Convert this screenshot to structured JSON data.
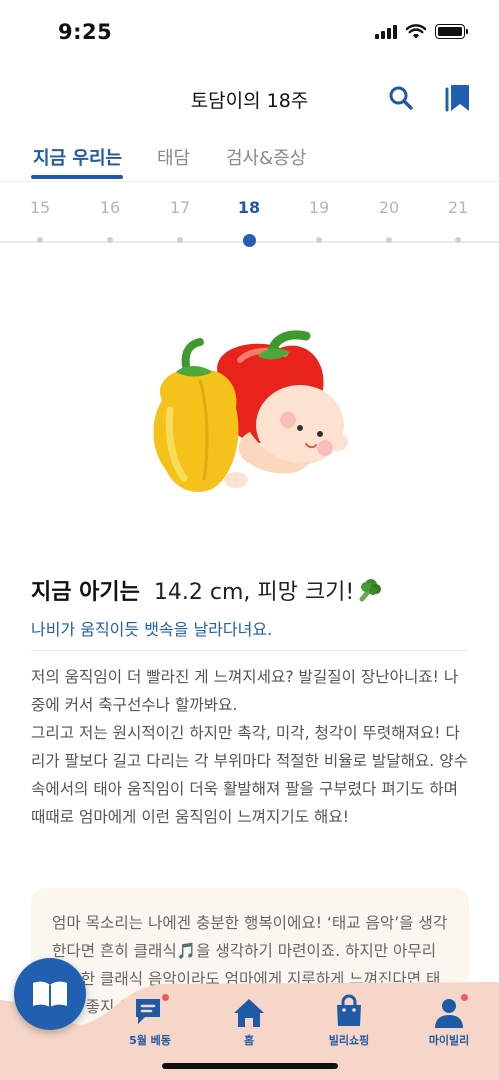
{
  "status_bar": {
    "time": "9:25"
  },
  "header": {
    "title": "토담이의 18주",
    "search_icon": "search-icon",
    "bookmark_icon": "bookmark-icon"
  },
  "tabs": [
    {
      "label": "지금 우리는",
      "active": true
    },
    {
      "label": "태담",
      "active": false
    },
    {
      "label": "검사&증상",
      "active": false
    }
  ],
  "weeks": [
    {
      "num": "15",
      "active": false
    },
    {
      "num": "16",
      "active": false
    },
    {
      "num": "17",
      "active": false
    },
    {
      "num": "18",
      "active": true
    },
    {
      "num": "19",
      "active": false
    },
    {
      "num": "20",
      "active": false
    },
    {
      "num": "21",
      "active": false
    }
  ],
  "baby": {
    "label": "지금 아기는",
    "size": "14.2 cm, 피망 크기!",
    "emoji_icon": "broccoli-icon",
    "subtitle": "나비가 움직이듯 뱃속을 날라다녀요.",
    "description": "저의 움직임이 더 빨라진 게 느껴지세요? 발길질이 장난아니죠! 나중에 커서 축구선수나 할까봐요.\n그리고 저는 원시적이긴 하지만 촉각, 미각, 청각이 뚜렷해져요! 다리가 팔보다 길고 다리는 각 부위마다 적절한 비율로 발달해요. 양수 속에서의 태아 움직임이 더욱 활발해져 팔을 구부렸다 펴기도 하며 때때로 엄마에게 이런 움직임이 느껴지기도 해요!"
  },
  "tip": {
    "text": "엄마 목소리는 나에겐 충분한 행복이에요! ‘태교 음악’을 생각한다면 흔히 클래식🎵을 생각하기 마련이죠. 하지만 아무리 훌륭한 클래식 음악이라도 엄마에게 지루하게 느껴진다면 태교에 좋지 않아요. 엄마가 즐겁게 들을 수 있는 음악을 선택하세요."
  },
  "bottom_nav": [
    {
      "label": "5월 베동",
      "icon": "chat-icon",
      "badge": true
    },
    {
      "label": "홈",
      "icon": "home-icon",
      "badge": false
    },
    {
      "label": "빌리쇼핑",
      "icon": "shopping-bag-icon",
      "badge": false
    },
    {
      "label": "마이빌리",
      "icon": "person-icon",
      "badge": true
    }
  ],
  "fab": {
    "icon": "book-icon"
  },
  "colors": {
    "accent": "#2160b0",
    "badge": "#f05a5a",
    "nav_bg": "#f6d6c8",
    "tip_bg": "#fbf6ef"
  }
}
